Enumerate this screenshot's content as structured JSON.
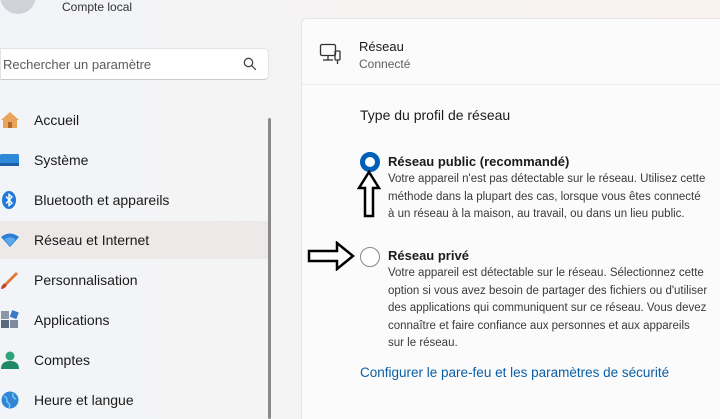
{
  "account": {
    "label": "Compte local"
  },
  "search": {
    "placeholder": "Rechercher un paramètre"
  },
  "nav": {
    "items": [
      {
        "label": "Accueil",
        "icon": "home-icon"
      },
      {
        "label": "Système",
        "icon": "display-icon"
      },
      {
        "label": "Bluetooth et appareils",
        "icon": "bluetooth-icon"
      },
      {
        "label": "Réseau et Internet",
        "icon": "wifi-icon",
        "selected": true
      },
      {
        "label": "Personnalisation",
        "icon": "brush-icon"
      },
      {
        "label": "Applications",
        "icon": "apps-icon"
      },
      {
        "label": "Comptes",
        "icon": "person-icon"
      },
      {
        "label": "Heure et langue",
        "icon": "globe-icon"
      }
    ]
  },
  "network": {
    "title": "Réseau",
    "status": "Connecté"
  },
  "profile": {
    "section_title": "Type du profil de réseau",
    "public": {
      "title": "Réseau public (recommandé)",
      "description": "Votre appareil n'est pas détectable sur le réseau. Utilisez cette méthode dans la plupart des cas, lorsque vous êtes connecté à un réseau à la maison, au travail, ou dans un lieu public.",
      "checked": true
    },
    "private": {
      "title": "Réseau privé",
      "description": "Votre appareil est détectable sur le réseau. Sélectionnez cette option si vous avez besoin de partager des fichiers ou d'utiliser des applications qui communiquent sur ce réseau. Vous devez connaître et faire confiance aux personnes et aux appareils sur le réseau.",
      "checked": false
    },
    "firewall_link": "Configurer le pare-feu et les paramètres de sécurité"
  },
  "colors": {
    "accent": "#005fb8",
    "link": "#0a5ea8",
    "selected_bg": "#ece9e8"
  }
}
